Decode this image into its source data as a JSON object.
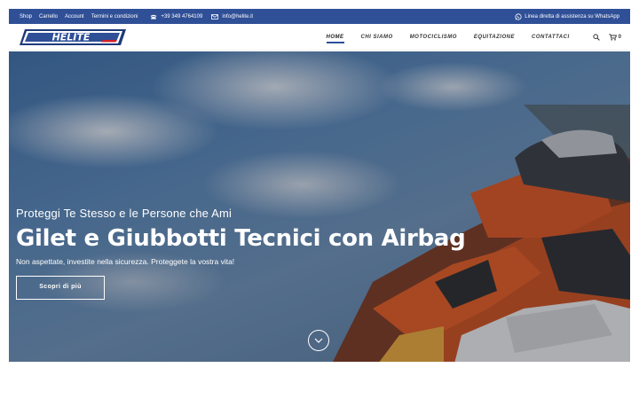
{
  "topbar": {
    "links": [
      "Shop",
      "Carrello",
      "Account",
      "Termini e condizioni"
    ],
    "phone": "+39 349 4764109",
    "email": "info@helite.it",
    "whatsapp": "Linea diretta di assistenza su WhatsApp"
  },
  "header": {
    "logo_text": "HELITE",
    "nav": [
      "HOME",
      "CHI SIAMO",
      "MOTOCICLISMO",
      "EQUITAZIONE",
      "CONTATTACI"
    ],
    "active_nav": "HOME",
    "cart_count": "0"
  },
  "hero": {
    "subtitle": "Proteggi Te Stesso e le Persone che Ami",
    "title": "Gilet e Giubbotti Tecnici con Airbag",
    "description": "Non aspettate, investite nella sicurezza. Proteggete la vostra vita!",
    "cta_label": "Scopri di più"
  },
  "colors": {
    "topbar_bg": "#2f4f97",
    "accent": "#2f4f97",
    "logo_red": "#d32027"
  },
  "icons": [
    "phone-icon",
    "mail-icon",
    "whatsapp-icon",
    "search-icon",
    "cart-icon",
    "chevron-down-icon"
  ]
}
